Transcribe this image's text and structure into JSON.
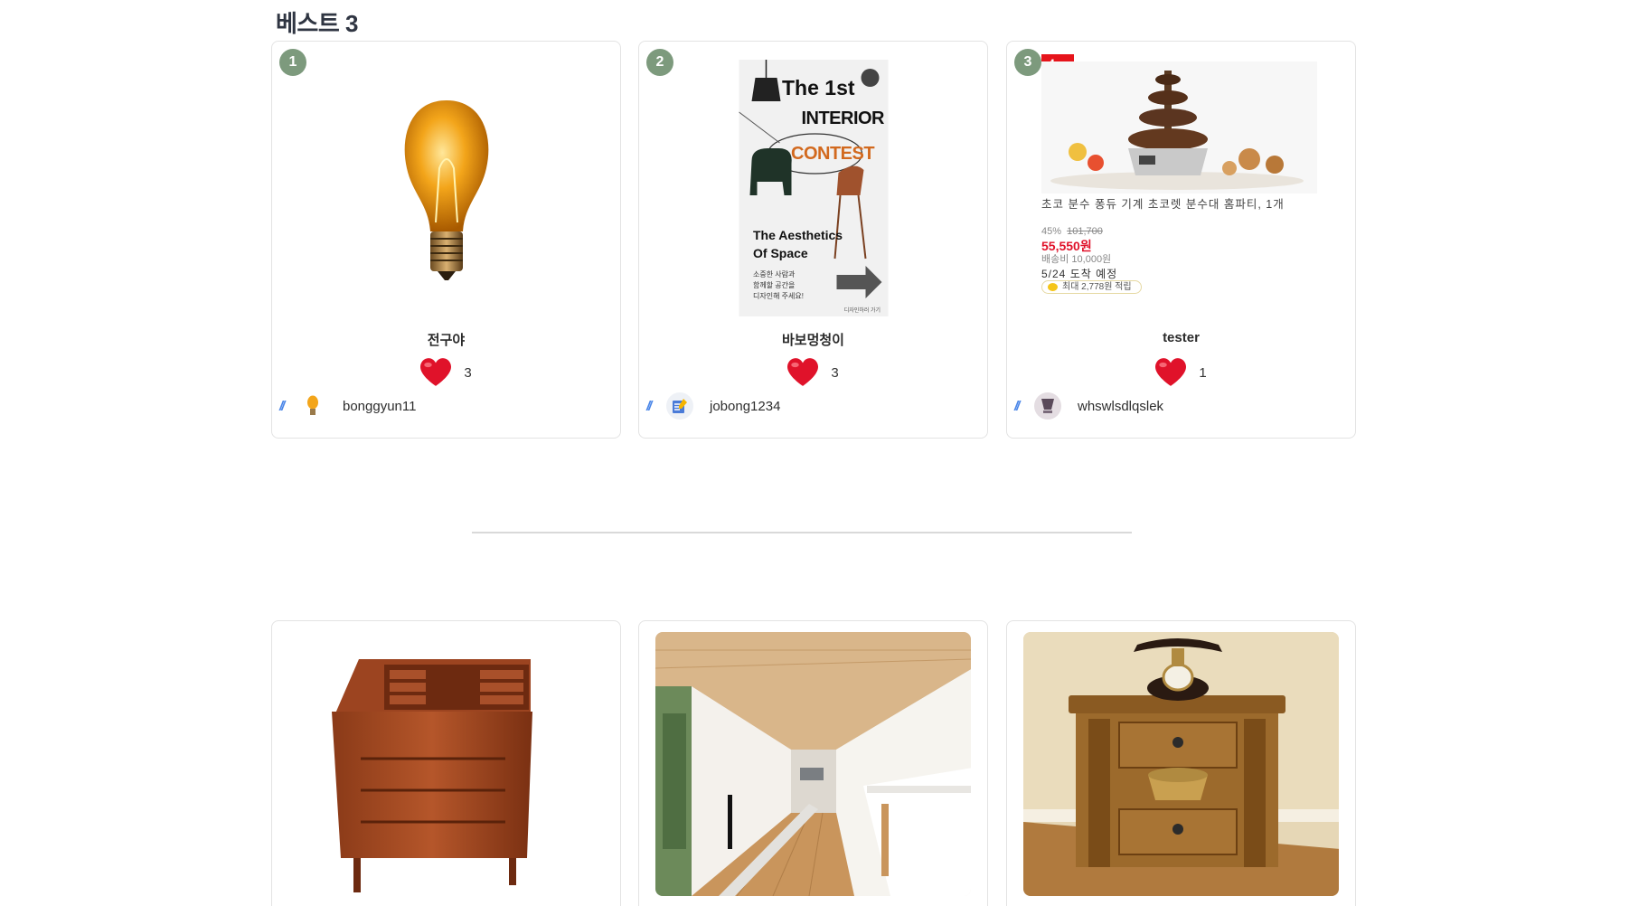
{
  "section": {
    "title": "베스트 3"
  },
  "best": [
    {
      "rank": "1",
      "title": "전구야",
      "likes": "3",
      "author": "bonggyun11",
      "image_icon": "lightbulb-image",
      "avatar_icon": "lightbulb-avatar-icon"
    },
    {
      "rank": "2",
      "title": "바보멍청이",
      "likes": "3",
      "author": "jobong1234",
      "image_icon": "interior-contest-poster",
      "avatar_icon": "notepad-avatar-icon",
      "poster": {
        "line1": "The 1st",
        "line2": "INTERIOR",
        "line3": "CONTEST",
        "line4": "The Aesthetics",
        "line5": "Of Space",
        "small1": "소중한 사람과",
        "small2": "함께할 공간을",
        "small3": "디자인해 주세요!",
        "footer": "디자인하러 가기"
      }
    },
    {
      "rank": "3",
      "title": "tester",
      "likes": "1",
      "author": "whswlsdlqslek",
      "image_icon": "chocolate-fountain-product",
      "avatar_icon": "cup-avatar-icon",
      "product": {
        "flag": "4",
        "name": "초코 분수 퐁듀 기계 초코렛 분수대 홈파티, 1개",
        "discount": "45%",
        "original_price": "101,700",
        "price": "55,550원",
        "shipping": "배송비 10,000원",
        "arrival": "5/24 도착 예정",
        "reward": "최대 2,778원 적립"
      }
    }
  ],
  "grid": [
    {
      "image_icon": "wooden-secretary-desk-image"
    },
    {
      "image_icon": "interior-hallway-kitchen-image"
    },
    {
      "image_icon": "wooden-nightstand-telephone-image"
    }
  ],
  "colors": {
    "rank_badge": "#7d9a7d",
    "heart": "#e0122a",
    "divider": "#d9d9d9",
    "edit_glyph": "#4a86e8"
  }
}
